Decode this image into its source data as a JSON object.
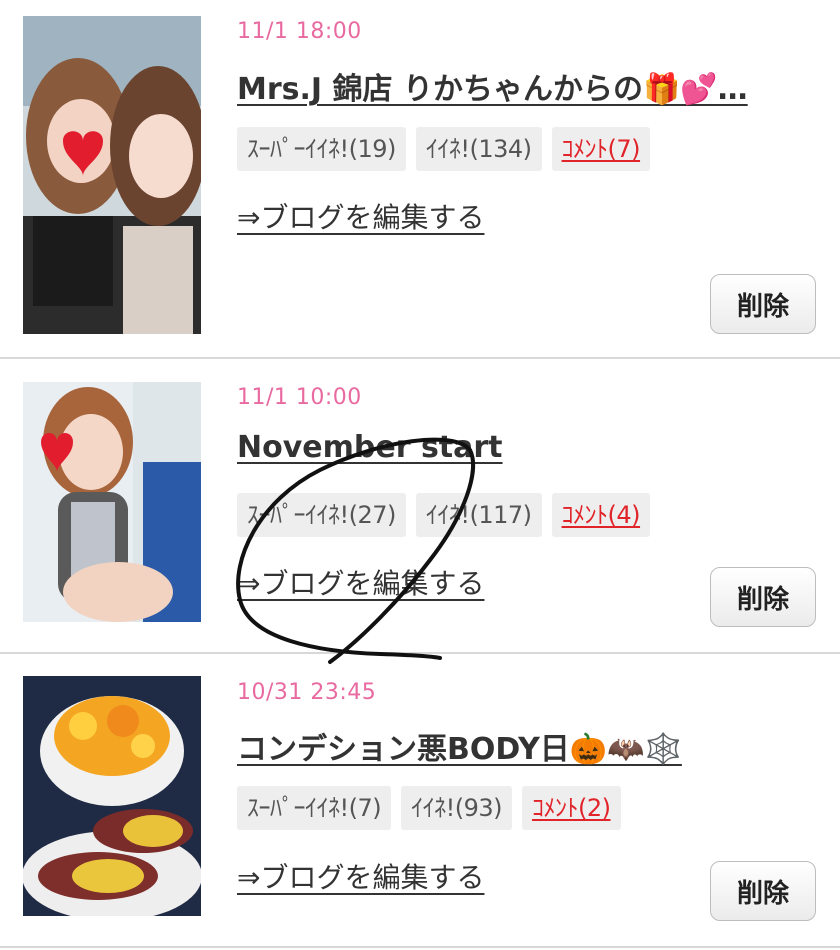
{
  "posts": [
    {
      "date": "11/1 18:00",
      "title": "Mrs.J 錦店 りかちゃんからの🎁💕…",
      "tags": {
        "super_like": "ｽｰﾊﾟｰｲｲﾈ!(19)",
        "like": "ｲｲﾈ!(134)",
        "comment": "ｺﾒﾝﾄ(7)"
      },
      "edit_link": "⇒ブログを編集する",
      "delete_label": "削除"
    },
    {
      "date": "11/1 10:00",
      "title": "November start",
      "tags": {
        "super_like": "ｽｰﾊﾟｰｲｲﾈ!(27)",
        "like": "ｲｲﾈ!(117)",
        "comment": "ｺﾒﾝﾄ(4)"
      },
      "edit_link": "⇒ブログを編集する",
      "delete_label": "削除"
    },
    {
      "date": "10/31 23:45",
      "title": "コンデション悪BODY日🎃🦇🕸️",
      "tags": {
        "super_like": "ｽｰﾊﾟｰｲｲﾈ!(7)",
        "like": "ｲｲﾈ!(93)",
        "comment": "ｺﾒﾝﾄ(2)"
      },
      "edit_link": "⇒ブログを編集する",
      "delete_label": "削除"
    }
  ],
  "colors": {
    "date": "#e86aa0",
    "comment": "#e0242a",
    "tag_bg": "#eeeeee",
    "divider": "#d8d8d8"
  },
  "thumbnails": [
    "photo-two-women-selfie",
    "photo-woman-swimsuit-pool",
    "photo-orange-dessert-sweet-potatoes"
  ]
}
